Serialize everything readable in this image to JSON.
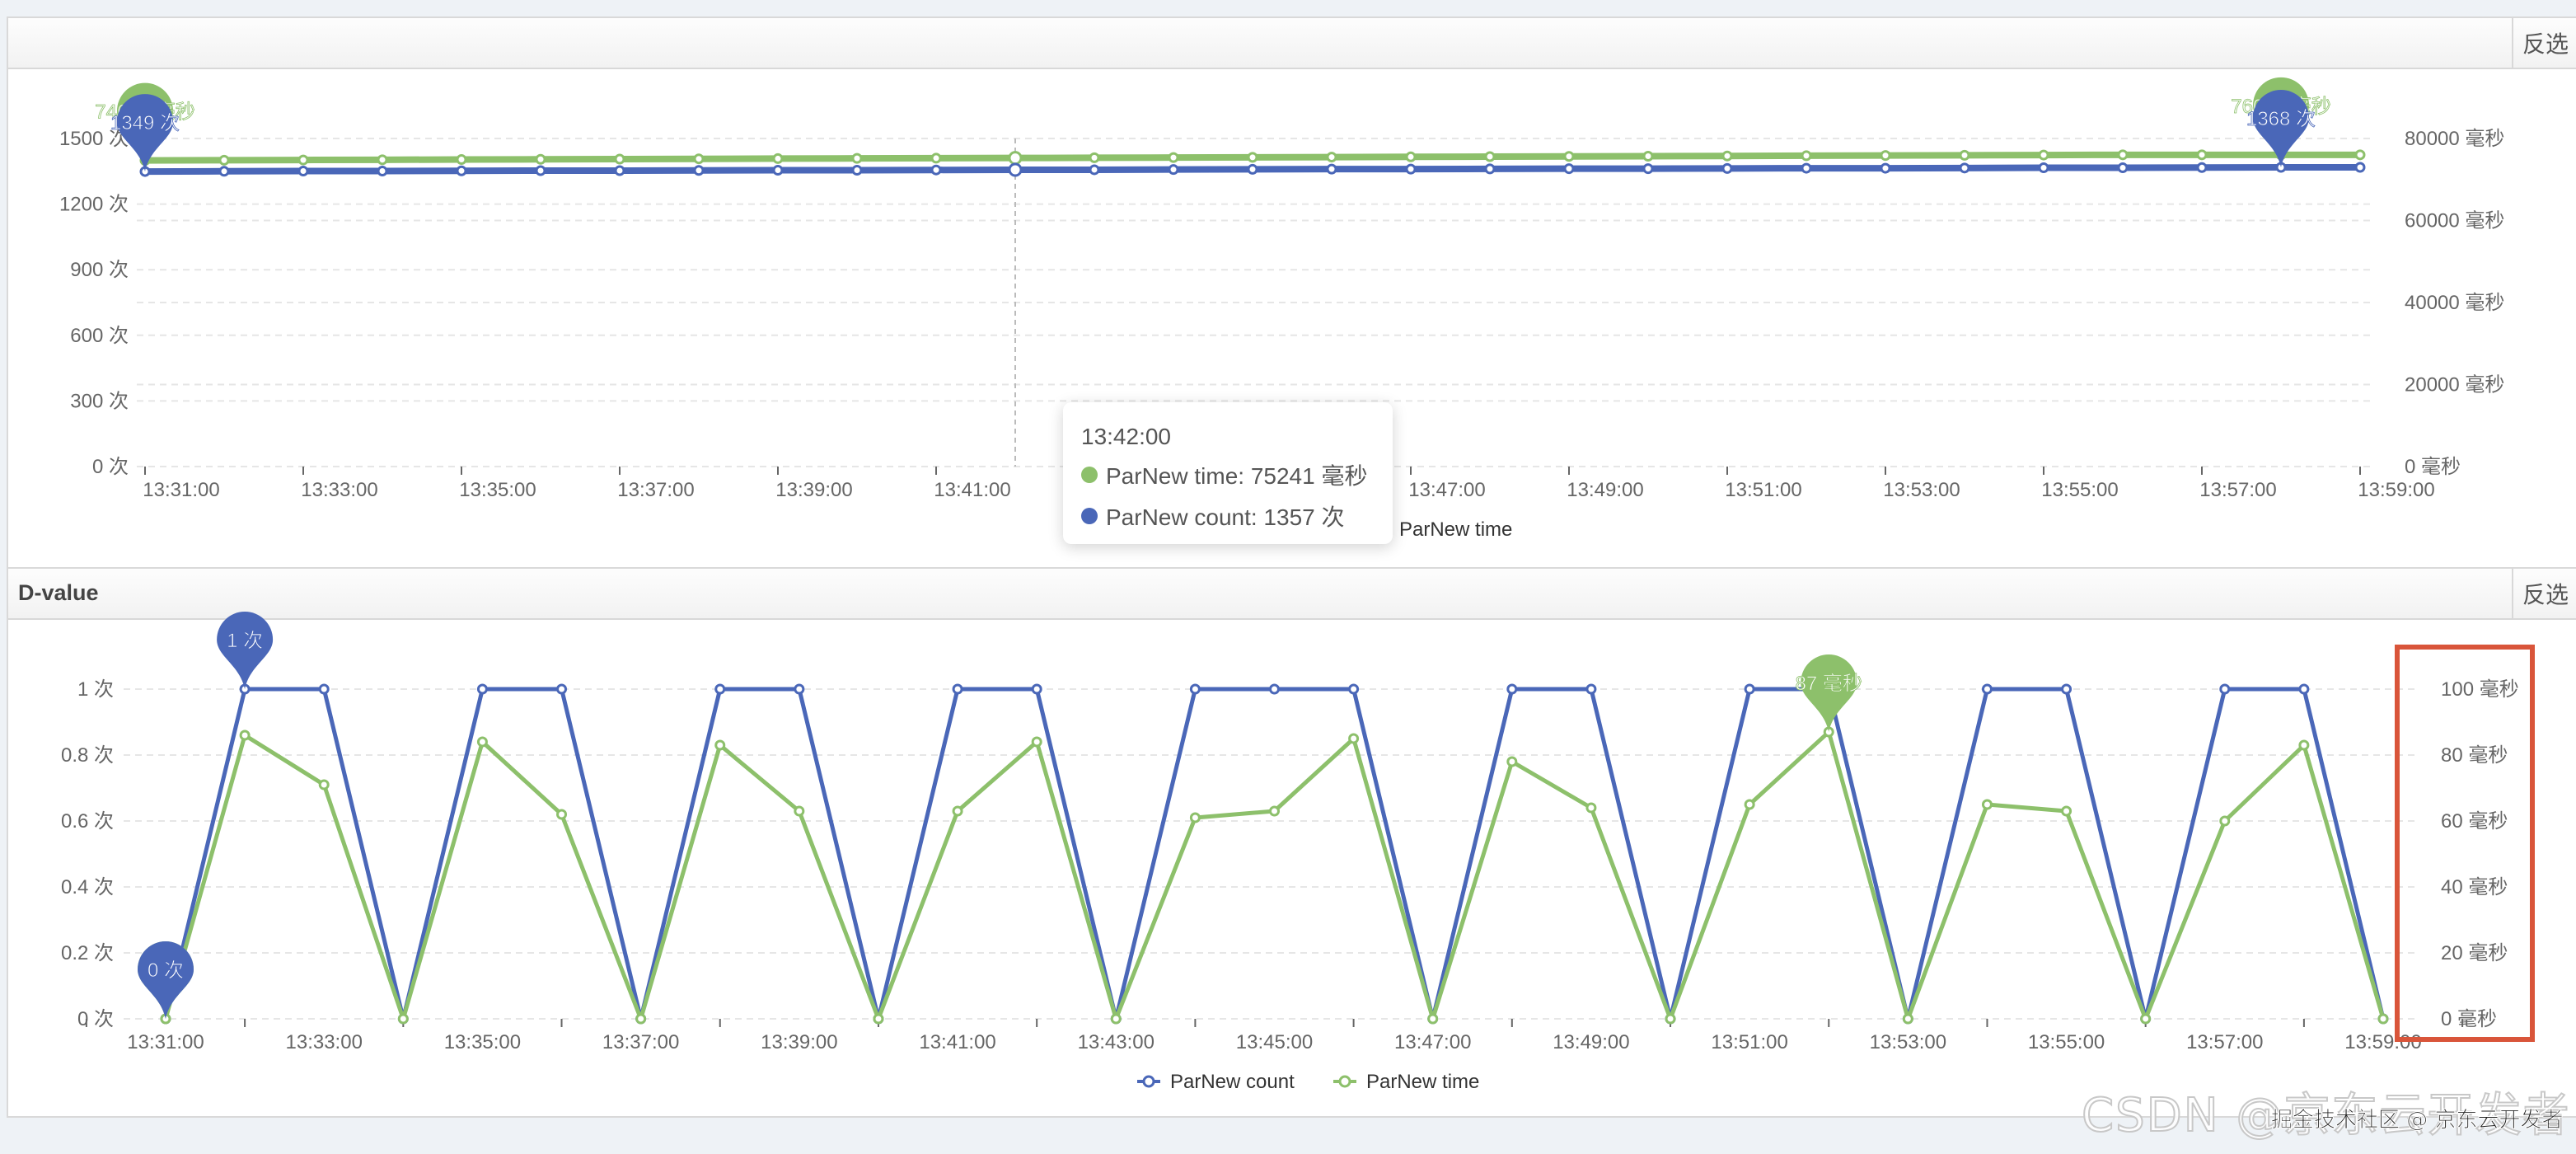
{
  "colors": {
    "count": "#4a67b8",
    "time": "#8dc06b",
    "highlight_box": "#d9553a"
  },
  "panels": {
    "top": {
      "title": "",
      "invert_label": "反选"
    },
    "bottom": {
      "title": "D-value",
      "invert_label": "反选"
    }
  },
  "tooltip": {
    "time": "13:42:00",
    "rows": [
      {
        "label": "ParNew time: 75241 毫秒",
        "series": "time"
      },
      {
        "label": "ParNew count: 1357 次",
        "series": "count"
      }
    ]
  },
  "watermark": {
    "main": "CSDN @京东云开发者",
    "secondary": "掘金技术社区 @ 京东云开发者"
  },
  "chart_data": [
    {
      "type": "line",
      "title": "",
      "x": [
        "13:31:00",
        "13:32:00",
        "13:33:00",
        "13:34:00",
        "13:35:00",
        "13:36:00",
        "13:37:00",
        "13:38:00",
        "13:39:00",
        "13:40:00",
        "13:41:00",
        "13:42:00",
        "13:43:00",
        "13:44:00",
        "13:45:00",
        "13:46:00",
        "13:47:00",
        "13:48:00",
        "13:49:00",
        "13:50:00",
        "13:51:00",
        "13:52:00",
        "13:53:00",
        "13:54:00",
        "13:55:00",
        "13:56:00",
        "13:57:00",
        "13:58:00",
        "13:59:00"
      ],
      "x_tick_labels": [
        "13:31:00",
        "13:33:00",
        "13:35:00",
        "13:37:00",
        "13:39:00",
        "13:41:00",
        "13:43:00",
        "13:45:00",
        "13:47:00",
        "13:49:00",
        "13:51:00",
        "13:53:00",
        "13:55:00",
        "13:57:00",
        "13:59:00"
      ],
      "y_left": {
        "unit": "次",
        "range": [
          0,
          1500
        ],
        "ticks": [
          0,
          300,
          600,
          900,
          1200,
          1500
        ],
        "tick_labels": [
          "0 次",
          "300 次",
          "600 次",
          "900 次",
          "1200 次",
          "1500 次"
        ]
      },
      "y_right": {
        "unit": "毫秒",
        "range": [
          0,
          80000
        ],
        "ticks": [
          0,
          20000,
          40000,
          60000,
          80000
        ],
        "tick_labels": [
          "0 毫秒",
          "20000 毫秒",
          "40000 毫秒",
          "60000 毫秒",
          "80000 毫秒"
        ]
      },
      "series": [
        {
          "name": "ParNew time",
          "axis": "right",
          "color": "#8dc06b",
          "values": [
            74645,
            74700,
            74756,
            74811,
            74867,
            74922,
            74978,
            75033,
            75089,
            75145,
            75193,
            75241,
            75297,
            75352,
            75408,
            75463,
            75519,
            75574,
            75630,
            75685,
            75741,
            75797,
            75852,
            75908,
            75963,
            76015,
            76015,
            76015,
            76015
          ]
        },
        {
          "name": "ParNew count",
          "axis": "left",
          "color": "#4a67b8",
          "values": [
            1349,
            1350,
            1351,
            1351,
            1352,
            1353,
            1353,
            1354,
            1355,
            1355,
            1356,
            1357,
            1357,
            1358,
            1359,
            1360,
            1360,
            1361,
            1362,
            1362,
            1363,
            1364,
            1364,
            1365,
            1366,
            1366,
            1367,
            1368,
            1368
          ]
        }
      ],
      "markers": [
        {
          "series": "ParNew time",
          "index": 0,
          "label": "74645 毫秒"
        },
        {
          "series": "ParNew count",
          "index": 0,
          "label": "1349 次"
        },
        {
          "series": "ParNew time",
          "index": 27,
          "label": "76015 毫秒"
        },
        {
          "series": "ParNew count",
          "index": 27,
          "label": "1368 次"
        }
      ],
      "hover_index": 11,
      "legend": {
        "position": "bottom",
        "items": [
          "ParNew count",
          "ParNew time"
        ]
      },
      "grid": true
    },
    {
      "type": "line",
      "title": "D-value",
      "x": [
        "13:31:00",
        "13:32:00",
        "13:33:00",
        "13:34:00",
        "13:35:00",
        "13:36:00",
        "13:37:00",
        "13:38:00",
        "13:39:00",
        "13:40:00",
        "13:41:00",
        "13:42:00",
        "13:43:00",
        "13:44:00",
        "13:45:00",
        "13:46:00",
        "13:47:00",
        "13:48:00",
        "13:49:00",
        "13:50:00",
        "13:51:00",
        "13:52:00",
        "13:53:00",
        "13:54:00",
        "13:55:00",
        "13:56:00",
        "13:57:00",
        "13:58:00",
        "13:59:00"
      ],
      "x_tick_labels": [
        "13:31:00",
        "13:33:00",
        "13:35:00",
        "13:37:00",
        "13:39:00",
        "13:41:00",
        "13:43:00",
        "13:45:00",
        "13:47:00",
        "13:49:00",
        "13:51:00",
        "13:53:00",
        "13:55:00",
        "13:57:00",
        "13:59:00"
      ],
      "y_left": {
        "unit": "次",
        "range": [
          0,
          1
        ],
        "ticks": [
          0,
          0.2,
          0.4,
          0.6,
          0.8,
          1
        ],
        "tick_labels": [
          "0 次",
          "0.2 次",
          "0.4 次",
          "0.6 次",
          "0.8 次",
          "1 次"
        ]
      },
      "y_right": {
        "unit": "毫秒",
        "range": [
          0,
          100
        ],
        "ticks": [
          0,
          20,
          40,
          60,
          80,
          100
        ],
        "tick_labels": [
          "0 毫秒",
          "20 毫秒",
          "40 毫秒",
          "60 毫秒",
          "80 毫秒",
          "100 毫秒"
        ]
      },
      "series": [
        {
          "name": "ParNew count",
          "axis": "left",
          "color": "#4a67b8",
          "values": [
            0,
            1,
            1,
            0,
            1,
            1,
            0,
            1,
            1,
            0,
            1,
            1,
            0,
            1,
            1,
            1,
            0,
            1,
            1,
            0,
            1,
            1,
            0,
            1,
            1,
            0,
            1,
            1,
            0
          ]
        },
        {
          "name": "ParNew time",
          "axis": "right",
          "color": "#8dc06b",
          "values": [
            0,
            86,
            71,
            0,
            84,
            62,
            0,
            83,
            63,
            0,
            63,
            84,
            0,
            61,
            63,
            85,
            0,
            78,
            64,
            0,
            65,
            87,
            0,
            65,
            63,
            0,
            60,
            83,
            0
          ]
        }
      ],
      "markers": [
        {
          "series": "ParNew count",
          "index": 1,
          "label": "1 次"
        },
        {
          "series": "ParNew time",
          "index": 21,
          "label": "87 毫秒"
        },
        {
          "series": "ParNew time",
          "index": 0,
          "label": "0 毫秒"
        },
        {
          "series": "ParNew count",
          "index": 0,
          "label": "0 次"
        }
      ],
      "legend": {
        "position": "bottom",
        "items": [
          "ParNew count",
          "ParNew time"
        ]
      },
      "grid": true
    }
  ]
}
